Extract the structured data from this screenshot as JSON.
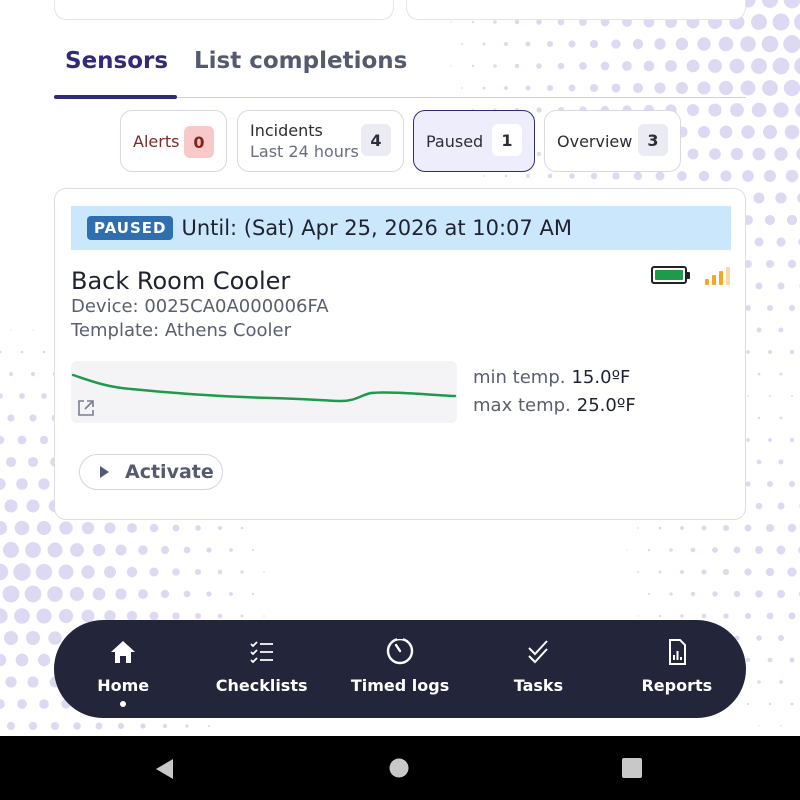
{
  "tabs": [
    {
      "label": "Sensors",
      "active": true
    },
    {
      "label": "List completions",
      "active": false
    }
  ],
  "filters": [
    {
      "label": "Alerts",
      "count": "0",
      "style": "alert"
    },
    {
      "label": "Incidents",
      "sublabel": "Last 24 hours",
      "count": "4",
      "style": "default"
    },
    {
      "label": "Paused",
      "count": "1",
      "style": "active"
    },
    {
      "label": "Overview",
      "count": "3",
      "style": "default"
    }
  ],
  "sensor": {
    "status_badge": "PAUSED",
    "paused_until": "Until: (Sat) Apr 25, 2026 at 10:07 AM",
    "name": "Back Room Cooler",
    "device": "Device: 0025CA0A000006FA",
    "template": "Template: Athens Cooler",
    "battery_icon": "battery-full-icon",
    "signal_icon": "signal-bars-icon",
    "min_temp_label": "min temp.",
    "min_temp_value": "15.0ºF",
    "max_temp_label": "max temp.",
    "max_temp_value": "25.0ºF",
    "activate_label": "Activate"
  },
  "nav": [
    {
      "label": "Home",
      "icon": "home-icon",
      "active": true
    },
    {
      "label": "Checklists",
      "icon": "checklist-icon",
      "active": false
    },
    {
      "label": "Timed logs",
      "icon": "timer-icon",
      "active": false
    },
    {
      "label": "Tasks",
      "icon": "double-check-icon",
      "active": false
    },
    {
      "label": "Reports",
      "icon": "report-icon",
      "active": false
    }
  ],
  "colors": {
    "accent": "#2f2a7a",
    "nav_bg": "#23263a",
    "banner_bg": "#cbe7fb",
    "badge_bg": "#2f6fb0",
    "sparkline": "#1f9a4a",
    "alert_badge": "#f8c9c9",
    "signal": "#f5a623"
  }
}
